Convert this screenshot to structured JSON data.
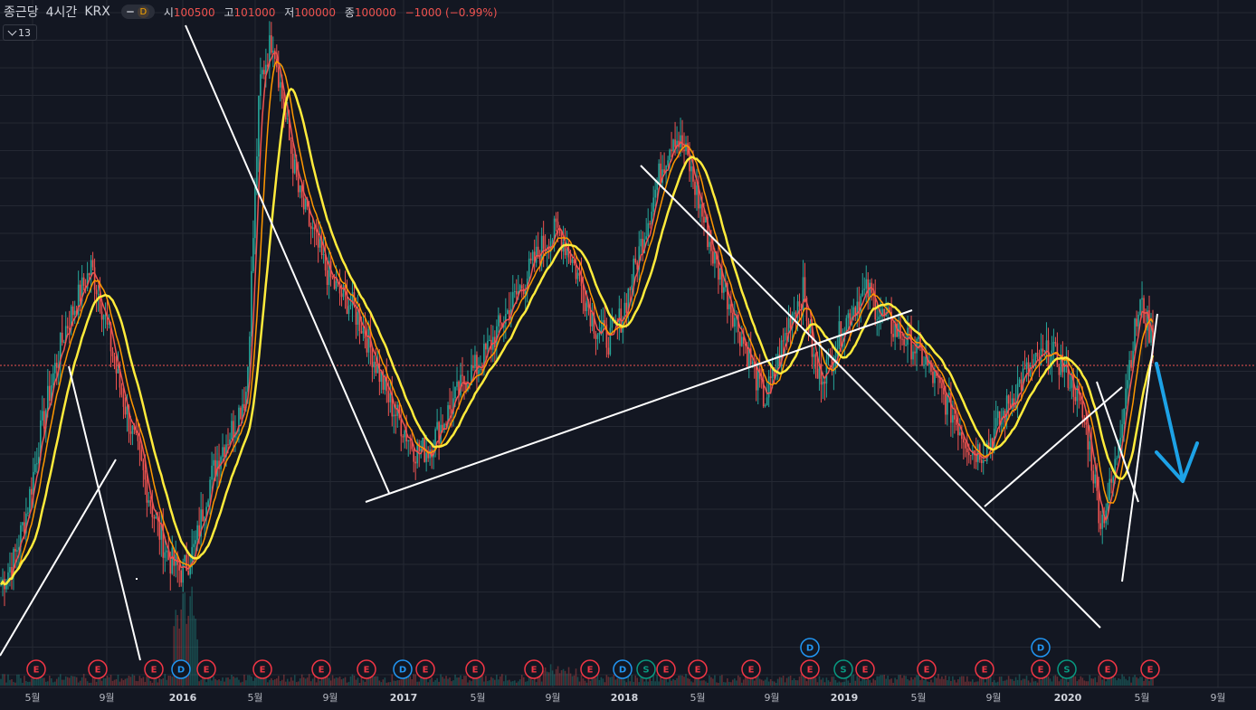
{
  "legend": {
    "symbol": "종근당",
    "interval": "4시간",
    "exchange": "KRX",
    "badge": "D",
    "open_label": "시",
    "open": "100500",
    "high_label": "고",
    "high": "101000",
    "low_label": "저",
    "low": "100000",
    "close_label": "종",
    "close": "100000",
    "change": "−1000 (−0.99%)"
  },
  "indicator_toggle": {
    "count": "13"
  },
  "colors": {
    "background": "#131722",
    "grid": "#242833",
    "up": "#26a69a",
    "down": "#ef5350",
    "ma_fast": "#ef5350",
    "ma_mid": "#ff9800",
    "ma_slow": "#ffeb3b",
    "trendline": "#ffffff",
    "arrow": "#1da2e6",
    "event_earnings": "#f23645",
    "event_dividend": "#2196f3",
    "event_split": "#089981"
  },
  "chart_data": {
    "type": "candlestick",
    "price_line": 100000,
    "x_axis": {
      "ticks": [
        {
          "label": "5월",
          "year": false
        },
        {
          "label": "9월",
          "year": false
        },
        {
          "label": "2016",
          "year": true
        },
        {
          "label": "5월",
          "year": false
        },
        {
          "label": "9월",
          "year": false
        },
        {
          "label": "2017",
          "year": true
        },
        {
          "label": "5월",
          "year": false
        },
        {
          "label": "9월",
          "year": false
        },
        {
          "label": "2018",
          "year": true
        },
        {
          "label": "5월",
          "year": false
        },
        {
          "label": "9월",
          "year": false
        },
        {
          "label": "2019",
          "year": true
        },
        {
          "label": "5월",
          "year": false
        },
        {
          "label": "9월",
          "year": false
        },
        {
          "label": "2020",
          "year": true
        },
        {
          "label": "5월",
          "year": false
        },
        {
          "label": "9월",
          "year": false
        }
      ]
    },
    "series": [
      {
        "name": "price",
        "values": [
          0.08,
          0.12,
          0.2,
          0.32,
          0.42,
          0.5,
          0.55,
          0.6,
          0.52,
          0.42,
          0.34,
          0.26,
          0.18,
          0.12,
          0.1,
          0.14,
          0.24,
          0.3,
          0.34,
          0.4,
          0.9,
          0.98,
          0.84,
          0.72,
          0.66,
          0.6,
          0.56,
          0.54,
          0.5,
          0.44,
          0.38,
          0.34,
          0.3,
          0.3,
          0.34,
          0.38,
          0.42,
          0.44,
          0.48,
          0.52,
          0.56,
          0.6,
          0.64,
          0.66,
          0.62,
          0.56,
          0.5,
          0.48,
          0.52,
          0.6,
          0.68,
          0.76,
          0.82,
          0.78,
          0.7,
          0.62,
          0.56,
          0.5,
          0.44,
          0.38,
          0.44,
          0.52,
          0.56,
          0.42,
          0.44,
          0.5,
          0.54,
          0.56,
          0.52,
          0.5,
          0.48,
          0.46,
          0.42,
          0.38,
          0.34,
          0.3,
          0.3,
          0.34,
          0.38,
          0.42,
          0.44,
          0.46,
          0.44,
          0.4,
          0.32,
          0.18,
          0.26,
          0.42,
          0.54,
          0.48
        ]
      }
    ],
    "trendlines": 11,
    "event_markers": [
      {
        "type": "E",
        "row": "bottom"
      },
      {
        "type": "E",
        "row": "bottom"
      },
      {
        "type": "E",
        "row": "bottom"
      },
      {
        "type": "D",
        "row": "bottom"
      },
      {
        "type": "E",
        "row": "bottom"
      },
      {
        "type": "E",
        "row": "bottom"
      },
      {
        "type": "E",
        "row": "bottom"
      },
      {
        "type": "E",
        "row": "bottom"
      },
      {
        "type": "D",
        "row": "bottom"
      },
      {
        "type": "E",
        "row": "bottom"
      },
      {
        "type": "E",
        "row": "bottom"
      },
      {
        "type": "E",
        "row": "bottom"
      },
      {
        "type": "E",
        "row": "bottom"
      },
      {
        "type": "D",
        "row": "bottom"
      },
      {
        "type": "S",
        "row": "bottom"
      },
      {
        "type": "E",
        "row": "bottom"
      },
      {
        "type": "E",
        "row": "bottom"
      },
      {
        "type": "E",
        "row": "bottom"
      },
      {
        "type": "E",
        "row": "bottom"
      },
      {
        "type": "D",
        "row": "top"
      },
      {
        "type": "S",
        "row": "bottom"
      },
      {
        "type": "E",
        "row": "bottom"
      },
      {
        "type": "E",
        "row": "bottom"
      },
      {
        "type": "E",
        "row": "bottom"
      },
      {
        "type": "E",
        "row": "bottom"
      },
      {
        "type": "D",
        "row": "top"
      },
      {
        "type": "S",
        "row": "bottom"
      },
      {
        "type": "E",
        "row": "bottom"
      },
      {
        "type": "E",
        "row": "bottom"
      }
    ]
  }
}
